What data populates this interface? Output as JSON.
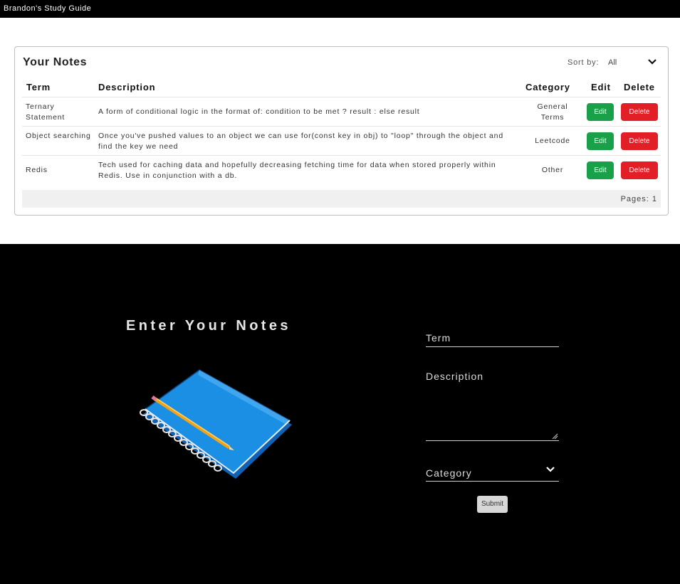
{
  "app": {
    "title": "Brandon's Study Guide"
  },
  "notes": {
    "heading": "Your Notes",
    "sort": {
      "label": "Sort by:",
      "value": "All"
    },
    "columns": {
      "term": "Term",
      "description": "Description",
      "category": "Category",
      "edit": "Edit",
      "delete": "Delete"
    },
    "rows": [
      {
        "term": "Ternary Statement",
        "description": "A form of conditional logic in the format of: condition to be met ? result : else result",
        "category": "General Terms"
      },
      {
        "term": "Object searching",
        "description": "Once you've pushed values to an object we can use for(const key in obj) to \"loop\" through the object and find the key we need",
        "category": "Leetcode"
      },
      {
        "term": "Redis",
        "description": "Tech used for caching data and hopefully decreasing fetching time for data when stored properly within Redis. Use in conjunction with a db.",
        "category": "Other"
      }
    ],
    "edit_label": "Edit",
    "delete_label": "Delete",
    "pages": "Pages:  1"
  },
  "form": {
    "heading": "Enter Your Notes",
    "term_label": "Term",
    "description_label": "Description",
    "category_label": "Category",
    "submit_label": "Submit"
  },
  "colors": {
    "edit": "#18a148",
    "delete": "#e21e26",
    "notebook": "#1a8fe3"
  },
  "icons": {
    "sort_toggle": "chevron-down-icon",
    "category_toggle": "chevron-down-icon",
    "illustration": "notebook-pencil-illustration"
  }
}
